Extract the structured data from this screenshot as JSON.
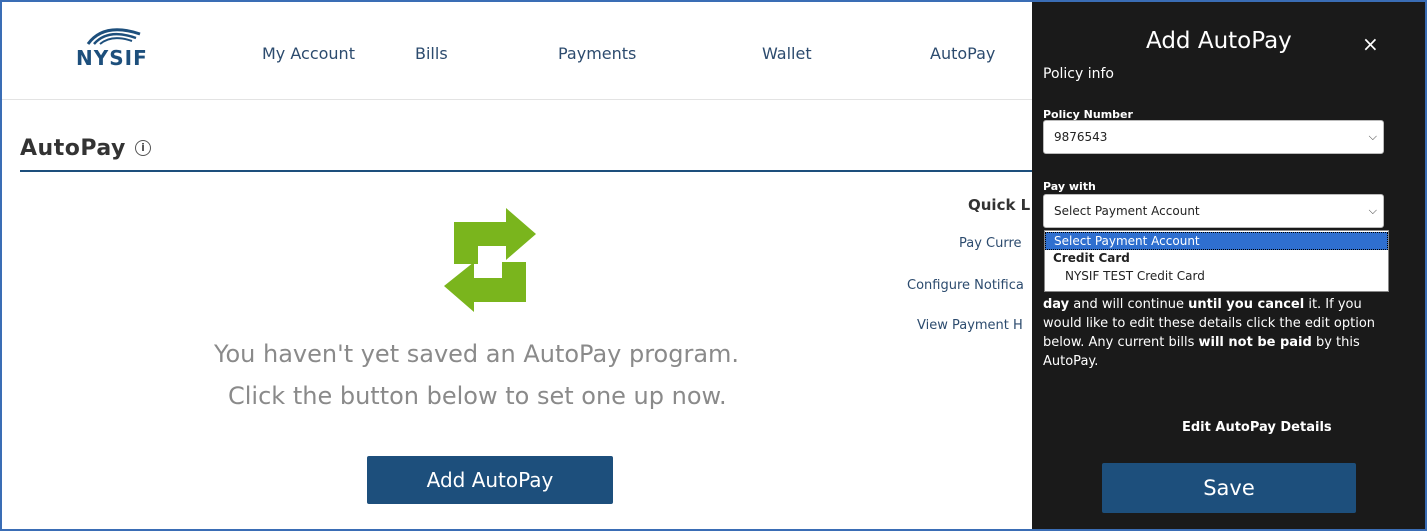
{
  "brand": {
    "name": "NYSIF"
  },
  "nav": [
    {
      "label": "My Account"
    },
    {
      "label": "Bills"
    },
    {
      "label": "Payments"
    },
    {
      "label": "Wallet"
    },
    {
      "label": "AutoPay"
    }
  ],
  "page": {
    "title": "AutoPay",
    "info_icon": "info-icon",
    "empty_line1": "You haven't yet saved an AutoPay program.",
    "empty_line2": "Click the button below to set one up now.",
    "add_button": "Add AutoPay"
  },
  "quick_links": {
    "title": "Quick L",
    "items": [
      "Pay Curre",
      "Configure Notifica",
      "View Payment H"
    ]
  },
  "panel": {
    "title": "Add AutoPay",
    "close": "×",
    "subtitle": "Policy info",
    "policy_label": "Policy Number",
    "policy_value": "9876543",
    "pay_label": "Pay with",
    "pay_value": "Select Payment Account",
    "dropdown": {
      "selected": "Select Payment Account",
      "group": "Credit Card",
      "option": "NYSIF TEST Credit Card"
    },
    "desc": {
      "t1": "day",
      "t2": " and will continue ",
      "t3": "until you cancel",
      "t4": " it. If you would like to edit these details click the edit option below. Any current bills ",
      "t5": "will not be paid",
      "t6": " by this AutoPay."
    },
    "edit_link": "Edit AutoPay Details",
    "save_button": "Save"
  },
  "colors": {
    "brand_blue": "#1d4f7c",
    "accent_green": "#7ab51d",
    "panel_bg": "#1a1a1a",
    "highlight": "#2f6fcf"
  }
}
